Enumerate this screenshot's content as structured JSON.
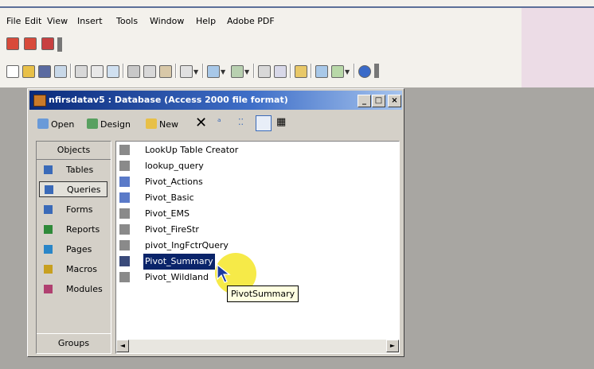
{
  "menubar": {
    "items": [
      "File",
      "Edit",
      "View",
      "Insert",
      "Tools",
      "Window",
      "Help",
      "Adobe PDF"
    ]
  },
  "colors": {
    "title_gradient_start": "#0a2a7a",
    "title_gradient_end": "#a6c4ee",
    "selection": "#0a246a",
    "highlight": "#f5e628",
    "tooltip_bg": "#ffffe1",
    "desktop": "#a8a6a2"
  },
  "window": {
    "title": "nfirsdatav5 : Database (Access 2000 file format)",
    "controls": {
      "minimize": "_",
      "restore": "□",
      "close": "×"
    },
    "toolbar": {
      "open": "Open",
      "design": "Design",
      "new": "New"
    }
  },
  "objects": {
    "header": "Objects",
    "items": [
      {
        "label": "Tables",
        "icon": "table-icon",
        "color": "#3a6ab8"
      },
      {
        "label": "Queries",
        "icon": "query-icon",
        "color": "#3a6ab8",
        "selected": true
      },
      {
        "label": "Forms",
        "icon": "form-icon",
        "color": "#3a6ab8"
      },
      {
        "label": "Reports",
        "icon": "report-icon",
        "color": "#2f8a3a"
      },
      {
        "label": "Pages",
        "icon": "page-icon",
        "color": "#2a86c8"
      },
      {
        "label": "Macros",
        "icon": "macro-icon",
        "color": "#c8a020"
      },
      {
        "label": "Modules",
        "icon": "module-icon",
        "color": "#b04070"
      }
    ],
    "groups": "Groups"
  },
  "queries": [
    {
      "name": "LookUp Table Creator",
      "icon": "action-query-icon"
    },
    {
      "name": "lookup_query",
      "icon": "action-query-icon"
    },
    {
      "name": "Pivot_Actions",
      "icon": "select-query-icon"
    },
    {
      "name": "Pivot_Basic",
      "icon": "select-query-icon"
    },
    {
      "name": "Pivot_EMS",
      "icon": "action-query-icon"
    },
    {
      "name": "Pivot_FireStr",
      "icon": "action-query-icon"
    },
    {
      "name": "pivot_IngFctrQuery",
      "icon": "action-query-icon"
    },
    {
      "name": "Pivot_Summary",
      "icon": "action-query-icon",
      "selected": true
    },
    {
      "name": "Pivot_Wildland",
      "icon": "action-query-icon"
    }
  ],
  "tooltip": "PivotSummary",
  "scroll": {
    "left": "◄",
    "right": "►"
  }
}
